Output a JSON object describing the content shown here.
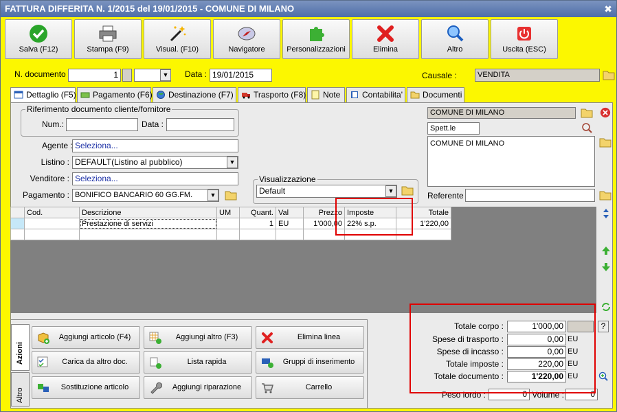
{
  "window": {
    "title": "FATTURA DIFFERITA N. 1/2015 del 19/01/2015 - COMUNE DI MILANO",
    "close": "✖"
  },
  "toolbar": {
    "buttons": [
      {
        "label": "Salva (F12)",
        "icon": "check-icon"
      },
      {
        "label": "Stampa (F9)",
        "icon": "printer-icon"
      },
      {
        "label": "Visual. (F10)",
        "icon": "magic-wand-icon"
      },
      {
        "label": "Navigatore",
        "icon": "compass-icon"
      },
      {
        "label": "Personalizzazioni",
        "icon": "puzzle-icon"
      },
      {
        "label": "Elimina",
        "icon": "delete-x-icon"
      },
      {
        "label": "Altro",
        "icon": "search-icon"
      },
      {
        "label": "Uscita (ESC)",
        "icon": "power-icon"
      }
    ]
  },
  "header": {
    "doc_number_label": "N. documento :",
    "doc_number": "1",
    "data_label": "Data :",
    "data": "19/01/2015",
    "causale_label": "Causale :",
    "causale": "VENDITA"
  },
  "tabs": [
    {
      "label": "Dettaglio (F5)",
      "active": true
    },
    {
      "label": "Pagamento (F6)"
    },
    {
      "label": "Destinazione (F7)"
    },
    {
      "label": "Trasporto (F8)"
    },
    {
      "label": "Note"
    },
    {
      "label": "Contabilita'"
    },
    {
      "label": "Documenti"
    }
  ],
  "riferimento": {
    "title": "Riferimento documento cliente/fornitore",
    "num_label": "Num.:",
    "num": "",
    "data_label": "Data :",
    "data": ""
  },
  "form": {
    "agente_label": "Agente :",
    "agente": "Seleziona...",
    "listino_label": "Listino :",
    "listino": "DEFAULT(Listino al pubblico)",
    "venditore_label": "Venditore :",
    "venditore": "Seleziona...",
    "pagamento_label": "Pagamento :",
    "pagamento": "BONIFICO BANCARIO 60 GG.FM."
  },
  "visualizzazione": {
    "title": "Visualizzazione",
    "value": "Default"
  },
  "cliente": {
    "name": "COMUNE DI MILANO",
    "salutation": "Spett.le",
    "address": "COMUNE DI MILANO",
    "referente_label": "Referente",
    "referente": ""
  },
  "grid": {
    "headers": [
      "Cod.",
      "Descrizione",
      "UM",
      "Quant.",
      "Val",
      "Prezzo",
      "Imposte",
      "Totale"
    ],
    "rows": [
      {
        "cod": "",
        "descrizione": "Prestazione di servizi",
        "um": "",
        "quant": "1",
        "val": "EU",
        "prezzo": "1'000,00",
        "imposte": "22% s.p.",
        "totale": "1'220,00"
      }
    ]
  },
  "actions": {
    "tabs": [
      "Azioni",
      "Altro"
    ],
    "buttons": [
      "Aggiungi articolo (F4)",
      "Aggiungi altro (F3)",
      "Elimina linea",
      "Carica da altro doc.",
      "Lista rapida",
      "Gruppi di inserimento",
      "Sostituzione articolo",
      "Aggiungi riparazione",
      "Carrello"
    ]
  },
  "totals": {
    "corpo_label": "Totale corpo :",
    "corpo": "1'000,00",
    "trasporto_label": "Spese di trasporto :",
    "trasporto": "0,00",
    "incasso_label": "Spese di incasso :",
    "incasso": "0,00",
    "imposte_label": "Totale imposte :",
    "imposte": "220,00",
    "documento_label": "Totale documento :",
    "documento": "1'220,00",
    "currency": "EU",
    "help": "?",
    "peso_label": "Peso lordo :",
    "peso": "0",
    "volume_label": "Volume :",
    "volume": "0"
  },
  "colors": {
    "background": "#fcf700",
    "highlight": "#e00000"
  }
}
